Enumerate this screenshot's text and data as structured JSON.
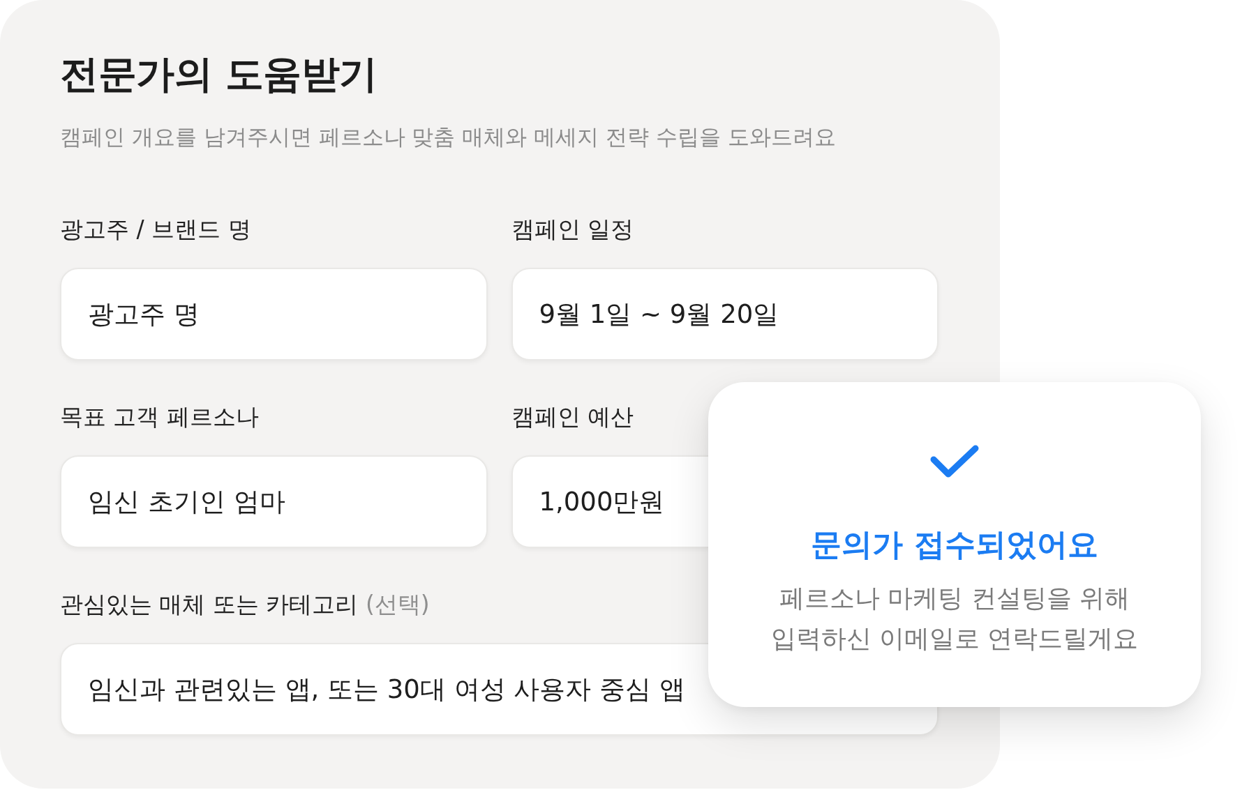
{
  "panel": {
    "title": "전문가의 도움받기",
    "subtitle": "캠페인 개요를 남겨주시면 페르소나 맞춤 매체와 메세지 전략 수립을 도와드려요"
  },
  "form": {
    "rows": [
      {
        "fields": [
          {
            "label": "광고주 / 브랜드 명",
            "value": "광고주 명"
          },
          {
            "label": "캠페인 일정",
            "value": "9월 1일 ~ 9월 20일"
          }
        ]
      },
      {
        "fields": [
          {
            "label": "목표 고객 페르소나",
            "value": "임신 초기인 엄마"
          },
          {
            "label": "캠페인 예산",
            "value": "1,000만원"
          }
        ]
      },
      {
        "fields": [
          {
            "label": "관심있는 매체 또는 카테고리",
            "note": "(선택)",
            "value": "임신과 관련있는 앱, 또는 30대 여성 사용자 중심 앱"
          }
        ]
      }
    ]
  },
  "toast": {
    "title": "문의가 접수되었어요",
    "message": [
      "페르소나 마케팅 컨설팅을 위해",
      "입력하신 이메일로 연락드릴게요"
    ]
  }
}
